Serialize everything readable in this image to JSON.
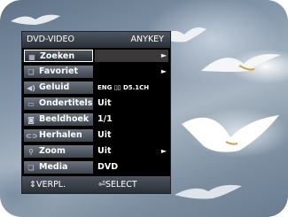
{
  "menu": {
    "title_left": "DVD-VIDEO",
    "title_right": "ANYKEY",
    "items": [
      {
        "label": "Zoeken",
        "value": "",
        "icon": "search-grid-icon",
        "arrow": true,
        "selected": true
      },
      {
        "label": "Favoriet",
        "value": "",
        "icon": "bookmark-icon",
        "arrow": true
      },
      {
        "label": "Geluid",
        "value": "ENG ▯▯ D5.1CH",
        "icon": "speaker-icon",
        "arrow": false
      },
      {
        "label": "Ondertitels",
        "value": "Uit",
        "icon": "subtitle-icon",
        "arrow": false
      },
      {
        "label": "Beeldhoek",
        "value": "1/1",
        "icon": "camera-angle-icon",
        "arrow": false
      },
      {
        "label": "Herhalen",
        "value": "Uit",
        "icon": "repeat-icon",
        "arrow": false
      },
      {
        "label": "Zoom",
        "value": "Uit",
        "icon": "zoom-icon",
        "arrow": true
      },
      {
        "label": "Media",
        "value": "DVD",
        "icon": "media-icon",
        "arrow": false
      }
    ],
    "footer_left": "VERPL.",
    "footer_right": "SELECT",
    "arrow_glyph": "►"
  },
  "colors": {
    "panel": "#000000",
    "label_gradient_top": "#6b7480",
    "label_gradient_bottom": "#3d444d",
    "header": "#4e5560",
    "sky": "#8799ac"
  }
}
